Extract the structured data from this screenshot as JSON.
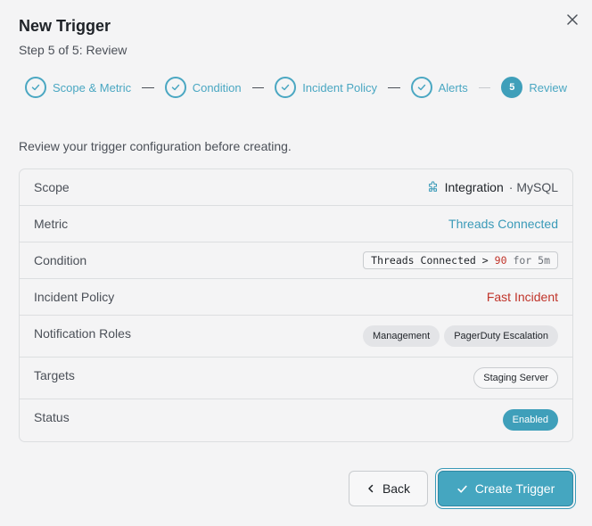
{
  "dialog": {
    "title": "New Trigger",
    "subtitle": "Step 5 of 5: Review",
    "intro": "Review your trigger configuration before creating."
  },
  "steps": [
    {
      "label": "Scope & Metric",
      "state": "complete"
    },
    {
      "label": "Condition",
      "state": "complete"
    },
    {
      "label": "Incident Policy",
      "state": "complete"
    },
    {
      "label": "Alerts",
      "state": "complete"
    },
    {
      "label": "Review",
      "number": "5",
      "state": "active"
    }
  ],
  "review": {
    "scope": {
      "label": "Scope",
      "type": "Integration",
      "name": "· MySQL"
    },
    "metric": {
      "label": "Metric",
      "value": "Threads Connected"
    },
    "condition": {
      "label": "Condition",
      "metric": "Threads Connected",
      "operator": ">",
      "threshold": "90",
      "duration": "for 5m"
    },
    "incident_policy": {
      "label": "Incident Policy",
      "value": "Fast Incident"
    },
    "notification_roles": {
      "label": "Notification Roles",
      "roles": [
        "Management",
        "PagerDuty Escalation"
      ]
    },
    "targets": {
      "label": "Targets",
      "items": [
        "Staging Server"
      ]
    },
    "status": {
      "label": "Status",
      "value": "Enabled"
    }
  },
  "buttons": {
    "back": "Back",
    "create": "Create Trigger"
  },
  "colors": {
    "accent": "#3f9fba",
    "danger": "#c0342a"
  },
  "icons": {
    "close": "close-icon",
    "step_complete": "check-icon",
    "scope": "puzzle-icon",
    "back": "chevron-left-icon",
    "create": "check-icon"
  }
}
